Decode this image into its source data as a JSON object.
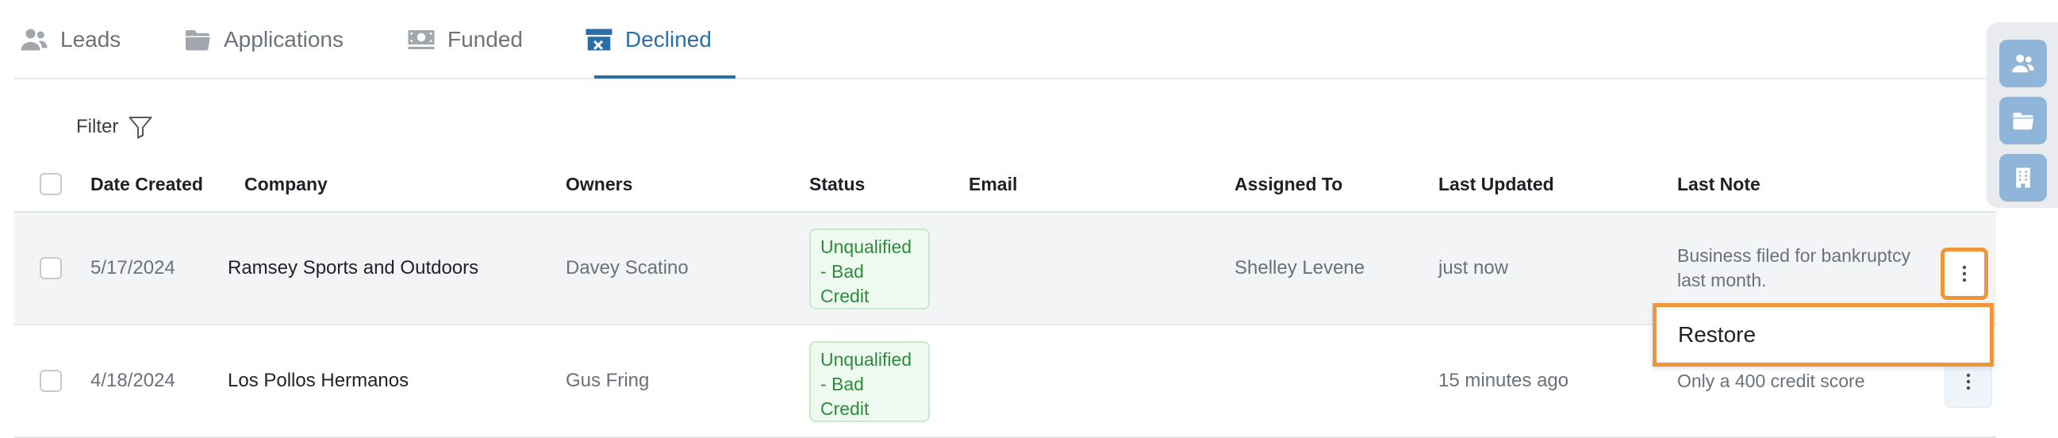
{
  "tabs": [
    {
      "label": "Leads",
      "icon": "users-icon"
    },
    {
      "label": "Applications",
      "icon": "folder-icon"
    },
    {
      "label": "Funded",
      "icon": "money-icon"
    },
    {
      "label": "Declined",
      "icon": "archive-x-icon",
      "active": true
    }
  ],
  "filter": {
    "label": "Filter"
  },
  "table": {
    "columns": [
      "Date Created",
      "Company",
      "Owners",
      "Status",
      "Email",
      "Assigned To",
      "Last Updated",
      "Last Note"
    ],
    "rows": [
      {
        "date_created": "5/17/2024",
        "company": "Ramsey Sports and Outdoors",
        "owners": "Davey Scatino",
        "status": "Unqualified\n- Bad\nCredit",
        "email": "",
        "assigned_to": "Shelley Levene",
        "last_updated": "just now",
        "last_note": "Business filed for bankruptcy last month."
      },
      {
        "date_created": "4/18/2024",
        "company": "Los Pollos Hermanos",
        "owners": "Gus Fring",
        "status": "Unqualified\n- Bad\nCredit",
        "email": "",
        "assigned_to": "",
        "last_updated": "15 minutes ago",
        "last_note": "Only a 400 credit score"
      }
    ]
  },
  "row_menu": {
    "items": [
      "Restore"
    ]
  },
  "colors": {
    "accent": "#2b6ea8",
    "highlight": "#f0963a",
    "status_text": "#2e8b3e",
    "status_bg": "#eef9ef",
    "rail_button": "#8fb6d8"
  },
  "right_rail": {
    "icons": [
      "users-icon",
      "folder-icon",
      "building-icon"
    ]
  }
}
